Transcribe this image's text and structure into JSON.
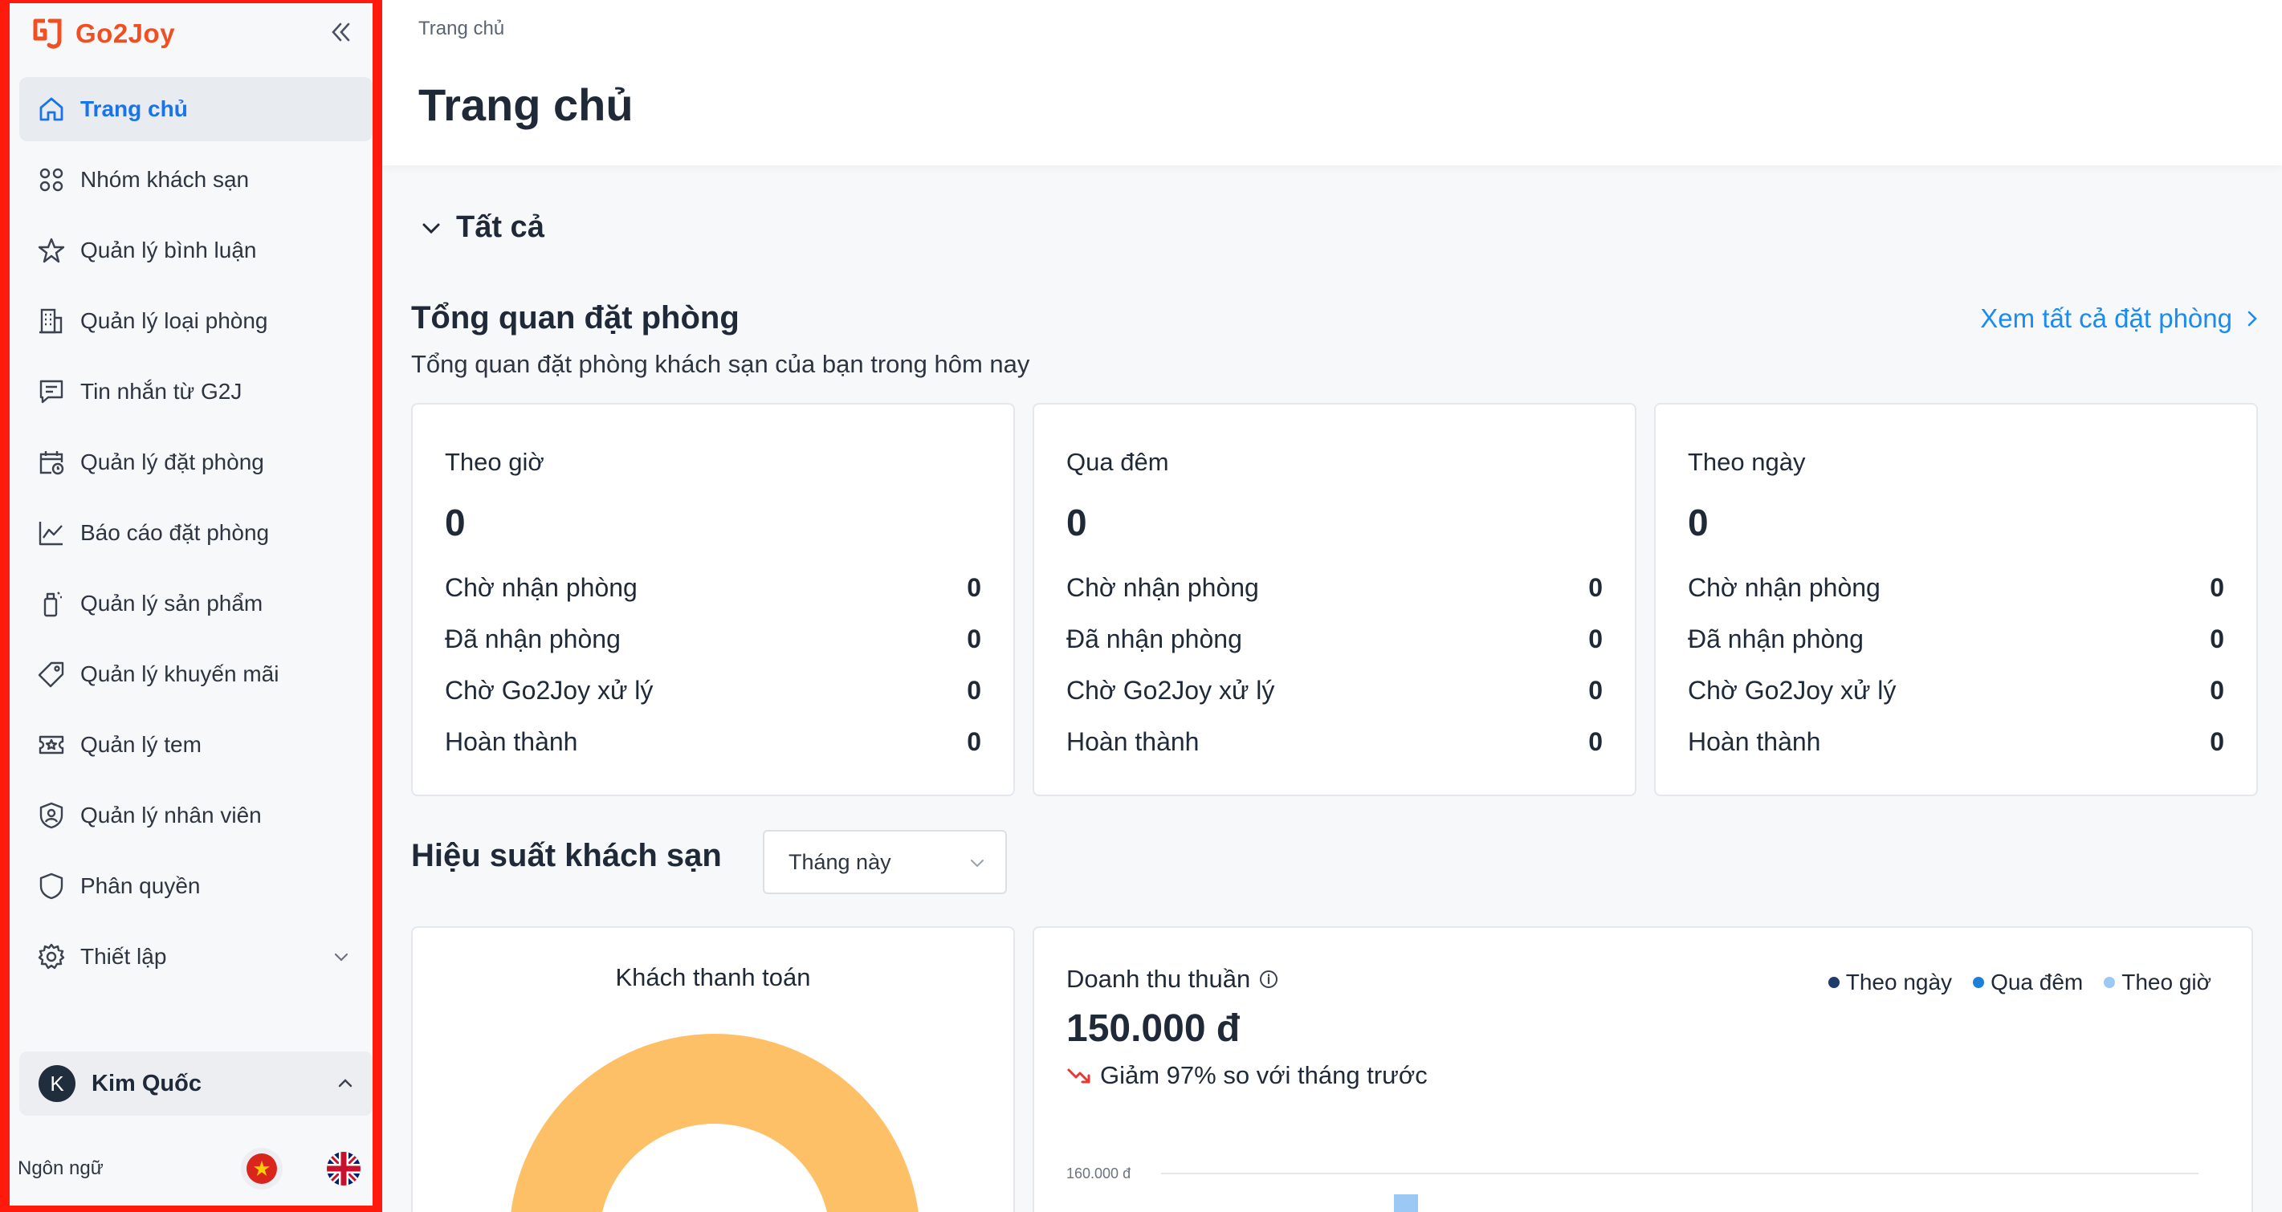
{
  "brand": {
    "name": "Go2Joy",
    "color": "#f04e23"
  },
  "sidebar": {
    "items": [
      {
        "label": "Trang chủ",
        "icon": "home-icon",
        "active": true
      },
      {
        "label": "Nhóm khách sạn",
        "icon": "grid-icon"
      },
      {
        "label": "Quản lý bình luận",
        "icon": "star-icon"
      },
      {
        "label": "Quản lý loại phòng",
        "icon": "building-icon"
      },
      {
        "label": "Tin nhắn từ G2J",
        "icon": "message-icon"
      },
      {
        "label": "Quản lý đặt phòng",
        "icon": "calendar-clock-icon"
      },
      {
        "label": "Báo cáo đặt phòng",
        "icon": "line-chart-icon"
      },
      {
        "label": "Quản lý sản phẩm",
        "icon": "bottle-icon"
      },
      {
        "label": "Quản lý khuyến mãi",
        "icon": "tag-icon"
      },
      {
        "label": "Quản lý tem",
        "icon": "ticket-icon"
      },
      {
        "label": "Quản lý nhân viên",
        "icon": "user-shield-icon"
      },
      {
        "label": "Phân quyền",
        "icon": "shield-icon"
      },
      {
        "label": "Thiết lập",
        "icon": "gear-icon"
      }
    ],
    "user": {
      "initial": "K",
      "name": "Kim Quốc"
    },
    "language_label": "Ngôn ngữ"
  },
  "header": {
    "breadcrumb": "Trang chủ",
    "title": "Trang chủ"
  },
  "section": {
    "label": "Tất cả"
  },
  "overview": {
    "title": "Tổng quan đặt phòng",
    "subtitle": "Tổng quan đặt phòng khách sạn của bạn trong hôm nay",
    "view_all": "Xem tất cả đặt phòng",
    "cards": [
      {
        "label": "Theo giờ",
        "total": "0",
        "rows": [
          {
            "label": "Chờ nhận phòng",
            "value": "0"
          },
          {
            "label": "Đã nhận phòng",
            "value": "0"
          },
          {
            "label": "Chờ Go2Joy xử lý",
            "value": "0"
          },
          {
            "label": "Hoàn thành",
            "value": "0"
          }
        ]
      },
      {
        "label": "Qua đêm",
        "total": "0",
        "rows": [
          {
            "label": "Chờ nhận phòng",
            "value": "0"
          },
          {
            "label": "Đã nhận phòng",
            "value": "0"
          },
          {
            "label": "Chờ Go2Joy xử lý",
            "value": "0"
          },
          {
            "label": "Hoàn thành",
            "value": "0"
          }
        ]
      },
      {
        "label": "Theo ngày",
        "total": "0",
        "rows": [
          {
            "label": "Chờ nhận phòng",
            "value": "0"
          },
          {
            "label": "Đã nhận phòng",
            "value": "0"
          },
          {
            "label": "Chờ Go2Joy xử lý",
            "value": "0"
          },
          {
            "label": "Hoàn thành",
            "value": "0"
          }
        ]
      }
    ]
  },
  "performance": {
    "title": "Hiệu suất khách sạn",
    "period": "Tháng này",
    "paying_guests": {
      "title": "Khách thanh toán",
      "color": "#fec066"
    },
    "revenue": {
      "title": "Doanh thu thuần",
      "value": "150.000 đ",
      "delta": "Giảm 97% so với tháng trước",
      "delta_color": "#e53935",
      "axis_tick": "160.000 đ",
      "legend": [
        {
          "label": "Theo ngày",
          "color": "#1f3c6e"
        },
        {
          "label": "Qua đêm",
          "color": "#1e7fd8"
        },
        {
          "label": "Theo giờ",
          "color": "#9cc8f5"
        }
      ]
    }
  }
}
